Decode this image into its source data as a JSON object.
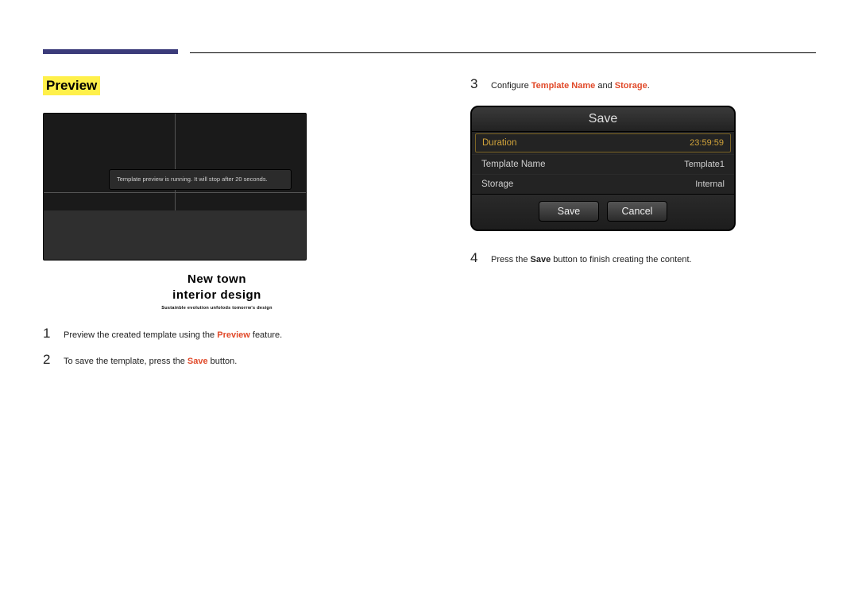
{
  "section_title": "Preview",
  "preview_popup": "Template preview is running. It will stop after 20 seconds.",
  "preview_caption": {
    "line1": "New town",
    "line2": "interior design",
    "sub": "Sustainble evolution unfolods tomorrw's design"
  },
  "left_steps": [
    {
      "num": "1",
      "pre": "Preview the created template using the ",
      "hl": "Preview",
      "post": " feature."
    },
    {
      "num": "2",
      "pre": "To save the template, press the ",
      "hl": "Save",
      "post": " button."
    }
  ],
  "right_steps": [
    {
      "num": "3",
      "pre": "Configure ",
      "hl1": "Template Name",
      "mid": " and ",
      "hl2": "Storage",
      "post": "."
    },
    {
      "num": "4",
      "pre": "Press the ",
      "bold": "Save",
      "post": " button to finish creating the content."
    }
  ],
  "dialog": {
    "title": "Save",
    "rows": [
      {
        "label": "Duration",
        "value": "23:59:59",
        "active": true
      },
      {
        "label": "Template Name",
        "value": "Template1",
        "active": false
      },
      {
        "label": "Storage",
        "value": "Internal",
        "active": false
      }
    ],
    "save": "Save",
    "cancel": "Cancel"
  }
}
